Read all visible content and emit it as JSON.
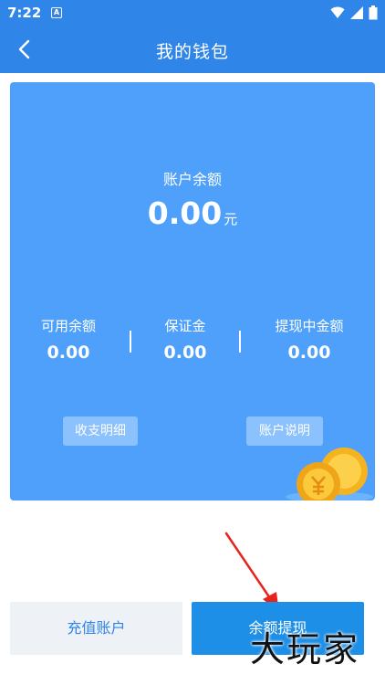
{
  "status_bar": {
    "time": "7:22",
    "app_icon_letter": "A",
    "icons": [
      "wifi-icon",
      "signal-icon",
      "battery-icon"
    ]
  },
  "header": {
    "title": "我的钱包",
    "back_icon": "chevron-left-icon"
  },
  "wallet": {
    "balance_label": "账户余额",
    "balance_value": "0.00",
    "balance_unit": "元",
    "stats": [
      {
        "label": "可用余额",
        "value": "0.00"
      },
      {
        "label": "保证金",
        "value": "0.00"
      },
      {
        "label": "提现中金额",
        "value": "0.00"
      }
    ],
    "details_button": "收支明细",
    "explain_button": "账户说明"
  },
  "actions": {
    "recharge_label": "充值账户",
    "withdraw_label": "余额提现"
  },
  "watermark": "大玩家",
  "colors": {
    "brand_blue": "#2f86e8",
    "card_blue": "#4ea0fb",
    "withdraw_blue": "#1e8fe6",
    "recharge_bg": "#eef1f5",
    "annotation_red": "#e8231b"
  }
}
